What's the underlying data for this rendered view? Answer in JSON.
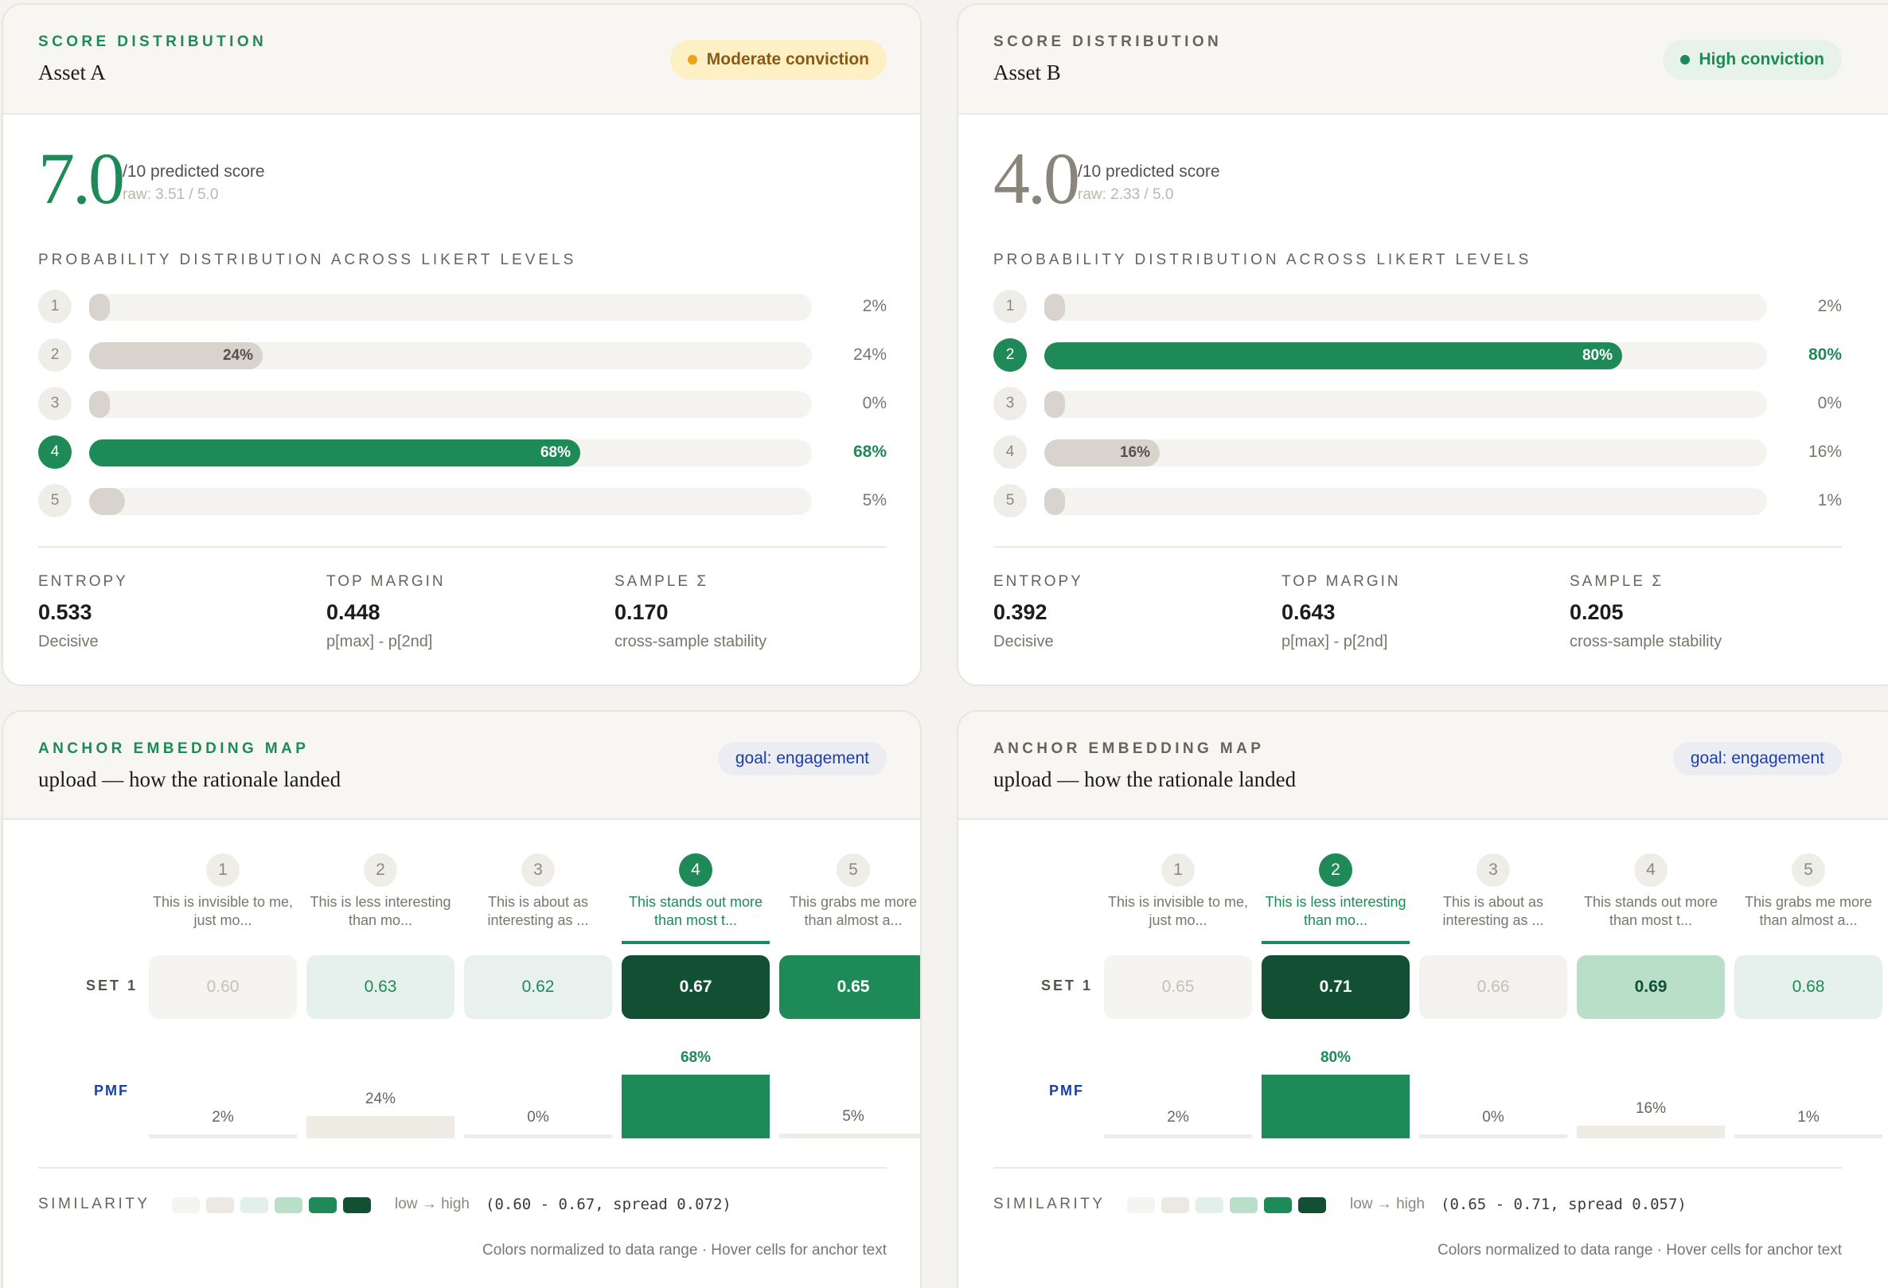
{
  "score_cards": [
    {
      "eyebrow": "SCORE DISTRIBUTION",
      "asset": "Asset A",
      "conviction": "Moderate conviction",
      "score": "7.0",
      "score_unit": "/10 predicted score",
      "raw": "raw: 3.51 / 5.0",
      "dist_label": "PROBABILITY DISTRIBUTION ACROSS LIKERT LEVELS",
      "levels": [
        {
          "num": "1",
          "pct": "2%",
          "value": 0.02,
          "inner": ""
        },
        {
          "num": "2",
          "pct": "24%",
          "value": 0.24,
          "inner": "24%"
        },
        {
          "num": "3",
          "pct": "0%",
          "value": 0.0,
          "inner": ""
        },
        {
          "num": "4",
          "pct": "68%",
          "value": 0.68,
          "inner": "68%",
          "active": true
        },
        {
          "num": "5",
          "pct": "5%",
          "value": 0.05,
          "inner": ""
        }
      ],
      "stats": [
        {
          "label": "ENTROPY",
          "value": "0.533",
          "sub": "Decisive"
        },
        {
          "label": "TOP MARGIN",
          "value": "0.448",
          "sub": "p[max] - p[2nd]"
        },
        {
          "label": "SAMPLE Σ",
          "value": "0.170",
          "sub": "cross-sample stability"
        }
      ]
    },
    {
      "eyebrow": "SCORE DISTRIBUTION",
      "asset": "Asset B",
      "conviction": "High conviction",
      "score": "4.0",
      "score_unit": "/10 predicted score",
      "raw": "raw: 2.33 / 5.0",
      "dist_label": "PROBABILITY DISTRIBUTION ACROSS LIKERT LEVELS",
      "levels": [
        {
          "num": "1",
          "pct": "2%",
          "value": 0.02,
          "inner": ""
        },
        {
          "num": "2",
          "pct": "80%",
          "value": 0.8,
          "inner": "80%",
          "active": true
        },
        {
          "num": "3",
          "pct": "0%",
          "value": 0.0,
          "inner": ""
        },
        {
          "num": "4",
          "pct": "16%",
          "value": 0.16,
          "inner": "16%"
        },
        {
          "num": "5",
          "pct": "1%",
          "value": 0.01,
          "inner": ""
        }
      ],
      "stats": [
        {
          "label": "ENTROPY",
          "value": "0.392",
          "sub": "Decisive"
        },
        {
          "label": "TOP MARGIN",
          "value": "0.643",
          "sub": "p[max] - p[2nd]"
        },
        {
          "label": "SAMPLE Σ",
          "value": "0.205",
          "sub": "cross-sample stability"
        }
      ]
    }
  ],
  "anchor_cards": [
    {
      "eyebrow": "ANCHOR EMBEDDING MAP",
      "title": "upload — how the rationale landed",
      "goal": "goal: engagement",
      "active_index": 3,
      "anchors": [
        {
          "num": "1",
          "line1": "This is invisible to me,",
          "line2": "just mo..."
        },
        {
          "num": "2",
          "line1": "This is less interesting",
          "line2": "than mo..."
        },
        {
          "num": "3",
          "line1": "This is about as",
          "line2": "interesting as ..."
        },
        {
          "num": "4",
          "line1": "This stands out more",
          "line2": "than most t..."
        },
        {
          "num": "5",
          "line1": "This grabs me more",
          "line2": "than almost a..."
        }
      ],
      "set_label": "SET 1",
      "cells": [
        {
          "value": "0.60",
          "bg": "#f5f4f1",
          "fg": "#c4c0b8"
        },
        {
          "value": "0.63",
          "bg": "#e6f0ec",
          "fg": "#1e8a57"
        },
        {
          "value": "0.62",
          "bg": "#e9f1ee",
          "fg": "#1e8a57"
        },
        {
          "value": "0.67",
          "bg": "#134f32",
          "fg": "#ffffff"
        },
        {
          "value": "0.65",
          "bg": "#1e8a57",
          "fg": "#ffffff"
        }
      ],
      "pmf_label": "PMF",
      "pmf": [
        {
          "label": "2%",
          "value": 0.02
        },
        {
          "label": "24%",
          "value": 0.24
        },
        {
          "label": "0%",
          "value": 0.0
        },
        {
          "label": "68%",
          "value": 0.68,
          "active": true
        },
        {
          "label": "5%",
          "value": 0.05
        }
      ],
      "legend_label": "SIMILARITY",
      "legend_text": "low → high",
      "legend_range": "(0.60 - 0.67, spread 0.072)",
      "footnote": "Colors normalized to data range · Hover cells for anchor text"
    },
    {
      "eyebrow": "ANCHOR EMBEDDING MAP",
      "title": "upload — how the rationale landed",
      "goal": "goal: engagement",
      "active_index": 1,
      "anchors": [
        {
          "num": "1",
          "line1": "This is invisible to me,",
          "line2": "just mo..."
        },
        {
          "num": "2",
          "line1": "This is less interesting",
          "line2": "than mo..."
        },
        {
          "num": "3",
          "line1": "This is about as",
          "line2": "interesting as ..."
        },
        {
          "num": "4",
          "line1": "This stands out more",
          "line2": "than most t..."
        },
        {
          "num": "5",
          "line1": "This grabs me more",
          "line2": "than almost a..."
        }
      ],
      "set_label": "SET 1",
      "cells": [
        {
          "value": "0.65",
          "bg": "#f5f4f1",
          "fg": "#c4c0b8"
        },
        {
          "value": "0.71",
          "bg": "#134f32",
          "fg": "#ffffff"
        },
        {
          "value": "0.66",
          "bg": "#f3f2ef",
          "fg": "#c4c0b8"
        },
        {
          "value": "0.69",
          "bg": "#b9dfc8",
          "fg": "#134f32"
        },
        {
          "value": "0.68",
          "bg": "#e6f0ec",
          "fg": "#1e8a57"
        }
      ],
      "pmf_label": "PMF",
      "pmf": [
        {
          "label": "2%",
          "value": 0.02
        },
        {
          "label": "80%",
          "value": 0.8,
          "active": true
        },
        {
          "label": "0%",
          "value": 0.0
        },
        {
          "label": "16%",
          "value": 0.16
        },
        {
          "label": "1%",
          "value": 0.01
        }
      ],
      "legend_label": "SIMILARITY",
      "legend_text": "low → high",
      "legend_range": "(0.65 - 0.71, spread 0.057)",
      "footnote": "Colors normalized to data range · Hover cells for anchor text"
    }
  ],
  "legend_swatches": [
    "#f5f4f1",
    "#ece9e3",
    "#e3f0ea",
    "#b9dfc8",
    "#1e8a57",
    "#134f32"
  ]
}
